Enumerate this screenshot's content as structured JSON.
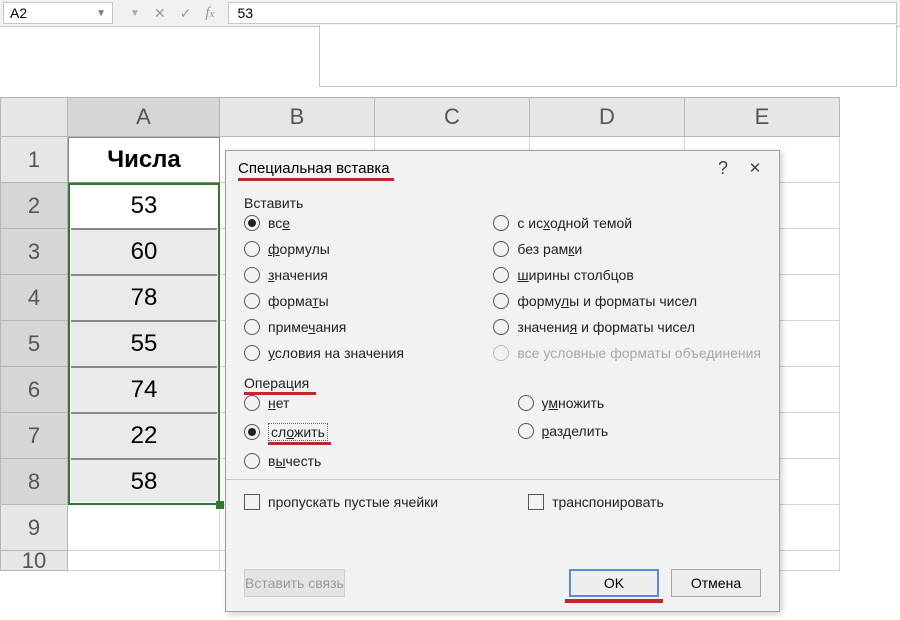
{
  "namebox": {
    "value": "A2"
  },
  "formula": {
    "value": "53"
  },
  "columns": [
    "A",
    "B",
    "C",
    "D",
    "E"
  ],
  "rows": {
    "header": "Числа",
    "values": [
      "53",
      "60",
      "78",
      "55",
      "74",
      "22",
      "58"
    ]
  },
  "dialog": {
    "title": "Специальная вставка",
    "help": "?",
    "close": "✕",
    "groups": {
      "paste": {
        "label": "Вставить",
        "left": [
          {
            "id": "all",
            "label_pre": "вс",
            "label_u": "е",
            "label_post": "",
            "checked": true
          },
          {
            "id": "formulas",
            "label_pre": "",
            "label_u": "ф",
            "label_post": "ормулы"
          },
          {
            "id": "values",
            "label_pre": "",
            "label_u": "з",
            "label_post": "начения"
          },
          {
            "id": "formats",
            "label_pre": "форма",
            "label_u": "т",
            "label_post": "ы"
          },
          {
            "id": "comments",
            "label_pre": "приме",
            "label_u": "ч",
            "label_post": "ания"
          },
          {
            "id": "validation",
            "label_pre": "",
            "label_u": "у",
            "label_post": "словия на значения"
          }
        ],
        "right": [
          {
            "id": "source-theme",
            "label_pre": "с ис",
            "label_u": "х",
            "label_post": "одной темой"
          },
          {
            "id": "no-border",
            "label_pre": "без рам",
            "label_u": "к",
            "label_post": "и"
          },
          {
            "id": "col-widths",
            "label_pre": "",
            "label_u": "ш",
            "label_post": "ирины столбцов"
          },
          {
            "id": "form-num",
            "label_pre": "форму",
            "label_u": "л",
            "label_post": "ы и форматы чисел"
          },
          {
            "id": "val-num",
            "label_pre": "значени",
            "label_u": "я",
            "label_post": " и форматы чисел"
          },
          {
            "id": "merge-cond",
            "label_pre": "все условные форматы объединения",
            "label_u": "",
            "label_post": "",
            "disabled": true
          }
        ]
      },
      "operation": {
        "label": "Операция",
        "left": [
          {
            "id": "none",
            "label_pre": "",
            "label_u": "н",
            "label_post": "ет"
          },
          {
            "id": "add",
            "label_pre": "сл",
            "label_u": "о",
            "label_post": "жить",
            "checked": true,
            "highlight": true
          },
          {
            "id": "subtract",
            "label_pre": "в",
            "label_u": "ы",
            "label_post": "честь"
          }
        ],
        "right": [
          {
            "id": "multiply",
            "label_pre": "у",
            "label_u": "м",
            "label_post": "ножить"
          },
          {
            "id": "divide",
            "label_pre": "",
            "label_u": "р",
            "label_post": "азделить"
          }
        ]
      }
    },
    "checkboxes": {
      "skip_blanks": "пропускать пустые ячейки",
      "transpose": "транспонировать"
    },
    "buttons": {
      "paste_link": "Вставить связь",
      "ok": "OK",
      "cancel": "Отмена"
    }
  }
}
